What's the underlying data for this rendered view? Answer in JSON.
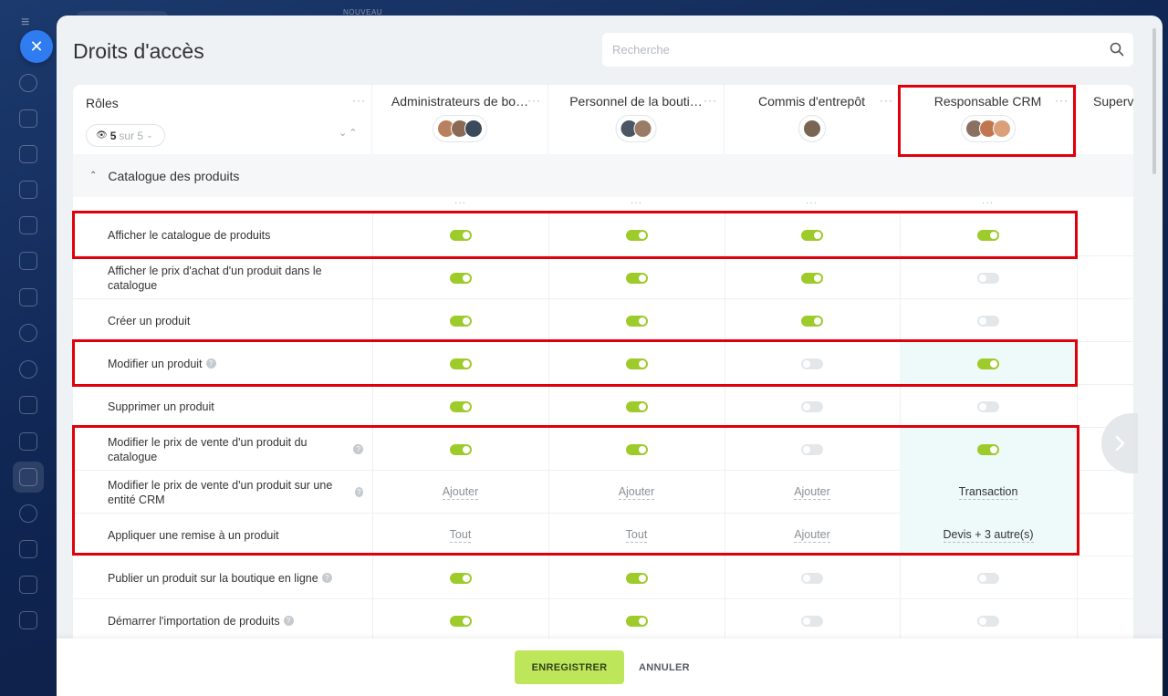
{
  "background": {
    "nouveau_label": "NOUVEAU"
  },
  "modal": {
    "title": "Droits d'accès",
    "search_placeholder": "Recherche"
  },
  "roles_header": {
    "title": "Rôles",
    "filter_count": "5",
    "filter_suffix": "sur 5"
  },
  "roles": [
    {
      "name": "Administrateurs de bo…",
      "avatars": [
        "#b9805f",
        "#8a6a55",
        "#3a4a5a"
      ]
    },
    {
      "name": "Personnel de la bouti…",
      "avatars": [
        "#4b5563",
        "#9a7b65"
      ]
    },
    {
      "name": "Commis d'entrepôt",
      "avatars": [
        "#7a6555"
      ]
    },
    {
      "name": "Responsable CRM",
      "avatars": [
        "#8a7060",
        "#c0774f",
        "#d9a07a"
      ]
    },
    {
      "name": "Superv",
      "avatars": []
    }
  ],
  "section": {
    "title": "Catalogue des produits"
  },
  "permissions": [
    {
      "label": "Afficher le catalogue de produits",
      "help": false,
      "values": [
        "on",
        "on",
        "on",
        "on"
      ]
    },
    {
      "label": "Afficher le prix d'achat d'un produit dans le catalogue",
      "help": false,
      "values": [
        "on",
        "on",
        "on",
        "off"
      ]
    },
    {
      "label": "Créer un produit",
      "help": false,
      "values": [
        "on",
        "on",
        "on",
        "off"
      ]
    },
    {
      "label": "Modifier un produit",
      "help": true,
      "values": [
        "on",
        "on",
        "off",
        "on"
      ]
    },
    {
      "label": "Supprimer un produit",
      "help": false,
      "values": [
        "on",
        "on",
        "off",
        "off"
      ]
    },
    {
      "label": "Modifier le prix de vente d'un produit du catalogue",
      "help": true,
      "values": [
        "on",
        "on",
        "off",
        "on"
      ]
    },
    {
      "label": "Modifier le prix de vente d'un produit sur une entité CRM",
      "help": true,
      "values": [
        "Ajouter",
        "Ajouter",
        "Ajouter",
        "Transaction"
      ]
    },
    {
      "label": "Appliquer une remise à un produit",
      "help": false,
      "values": [
        "Tout",
        "Tout",
        "Ajouter",
        "Devis + 3 autre(s)"
      ]
    },
    {
      "label": "Publier un produit sur la boutique en ligne",
      "help": true,
      "values": [
        "on",
        "on",
        "off",
        "off"
      ]
    },
    {
      "label": "Démarrer l'importation de produits",
      "help": true,
      "values": [
        "on",
        "on",
        "off",
        "off"
      ]
    }
  ],
  "footer": {
    "save_label": "ENREGISTRER",
    "cancel_label": "ANNULER"
  },
  "colors": {
    "toggle_on": "#9dcb2a",
    "toggle_off": "#e4e7ea",
    "highlight": "#e0000b",
    "save_button": "#bde65a"
  }
}
